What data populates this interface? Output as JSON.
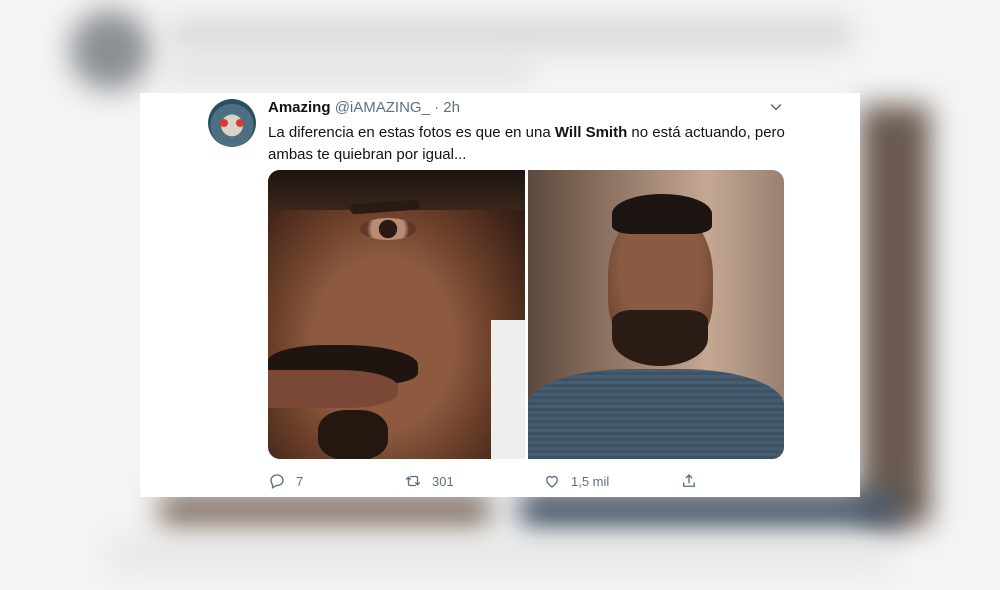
{
  "tweet": {
    "name": "Amazing",
    "handle": "@iAMAZING_",
    "separator": "·",
    "time": "2h",
    "text_before": "La diferencia en estas fotos es que en una ",
    "text_bold": "Will Smith",
    "text_after": " no está actuando, pero ambas te quiebran por igual..."
  },
  "actions": {
    "replies": "7",
    "retweets": "301",
    "likes": "1,5 mil"
  },
  "icons": {
    "more": "chevron-down-icon",
    "reply": "reply-icon",
    "retweet": "retweet-icon",
    "like": "heart-icon",
    "share": "share-icon"
  },
  "colors": {
    "text": "#0f1419",
    "muted": "#5b7083",
    "card": "#ffffff"
  }
}
